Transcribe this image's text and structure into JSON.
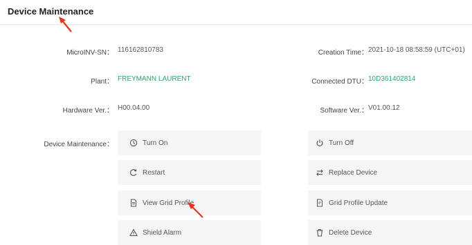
{
  "header": {
    "title": "Device Maintenance"
  },
  "info": {
    "sn_label": "MicroINV-SN：",
    "sn_value": "116162810783",
    "plant_label": "Plant：",
    "plant_value": "FREYMANN LAURENT",
    "hardware_label": "Hardware Ver.：",
    "hardware_value": "H00.04.00",
    "creation_label": "Creation Time：",
    "creation_value": "2021-10-18 08:58:59 (UTC+01)",
    "dtu_label": "Connected DTU：",
    "dtu_value": "10D361402814",
    "software_label": "Software Ver.：",
    "software_value": "V01.00.12"
  },
  "maintenance": {
    "label": "Device Maintenance：",
    "buttons": {
      "turn_on": "Turn On",
      "turn_off": "Turn Off",
      "restart": "Restart",
      "replace_device": "Replace Device",
      "view_grid_profile": "View Grid Profile",
      "grid_profile_update": "Grid Profile Update",
      "shield_alarm": "Shield Alarm",
      "delete_device": "Delete Device"
    }
  },
  "icons": {
    "turn_on": "clock-icon",
    "turn_off": "power-icon",
    "restart": "restart-icon",
    "replace_device": "swap-icon",
    "view_grid_profile": "document-icon",
    "grid_profile_update": "document-update-icon",
    "shield_alarm": "warning-icon",
    "delete_device": "trash-icon"
  },
  "colors": {
    "link": "#2ea56a",
    "annotation_arrow": "#e8341c",
    "button_bg": "#f5f5f5"
  }
}
